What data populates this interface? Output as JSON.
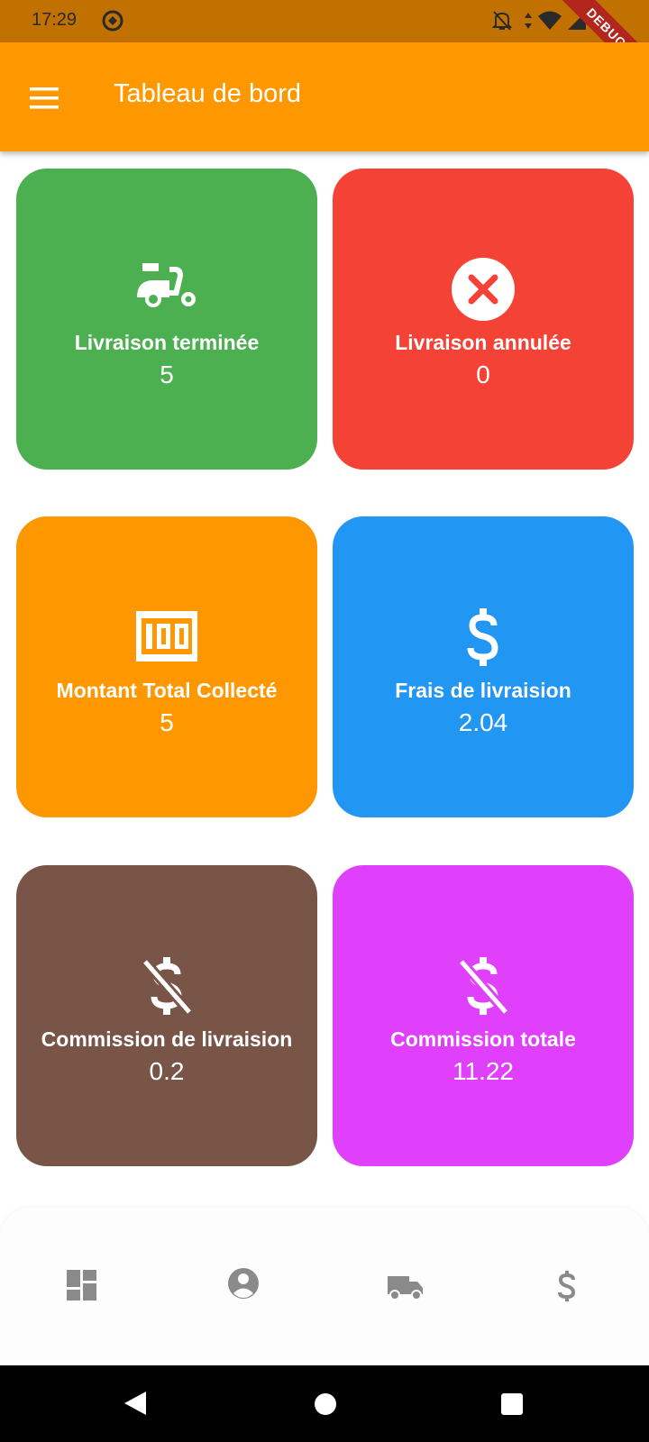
{
  "status_bar": {
    "time": "17:29",
    "debug_label": "DEBUG",
    "icons": [
      "sync-icon",
      "bell-off-icon",
      "data-arrows-icon",
      "wifi-icon",
      "signal-icon",
      "battery-icon"
    ]
  },
  "app_bar": {
    "title": "Tableau de bord",
    "menu_icon": "menu-icon"
  },
  "cards": [
    {
      "title": "Livraison terminée",
      "value": "5",
      "color": "#4caf50",
      "icon": "moped-icon"
    },
    {
      "title": "Livraison annulée",
      "value": "0",
      "color": "#f44336",
      "icon": "cancel-icon"
    },
    {
      "title": "Montant Total Collecté",
      "value": "5",
      "color": "#ff9800",
      "icon": "money-100-icon"
    },
    {
      "title": "Frais de livraision",
      "value": "2.04",
      "color": "#2196f3",
      "icon": "dollar-icon"
    },
    {
      "title": "Commission de livraision",
      "value": "0.2",
      "color": "#795548",
      "icon": "money-off-icon"
    },
    {
      "title": "Commission totale",
      "value": "11.22",
      "color": "#e040fb",
      "icon": "money-off-icon"
    }
  ],
  "bottom_nav": {
    "items": [
      {
        "icon": "dashboard-icon"
      },
      {
        "icon": "account-circle-icon"
      },
      {
        "icon": "truck-icon"
      },
      {
        "icon": "dollar-icon"
      }
    ],
    "icon_color": "#8a8a8a"
  },
  "system_nav": {
    "items": [
      "back-icon",
      "home-icon",
      "recents-icon"
    ]
  }
}
